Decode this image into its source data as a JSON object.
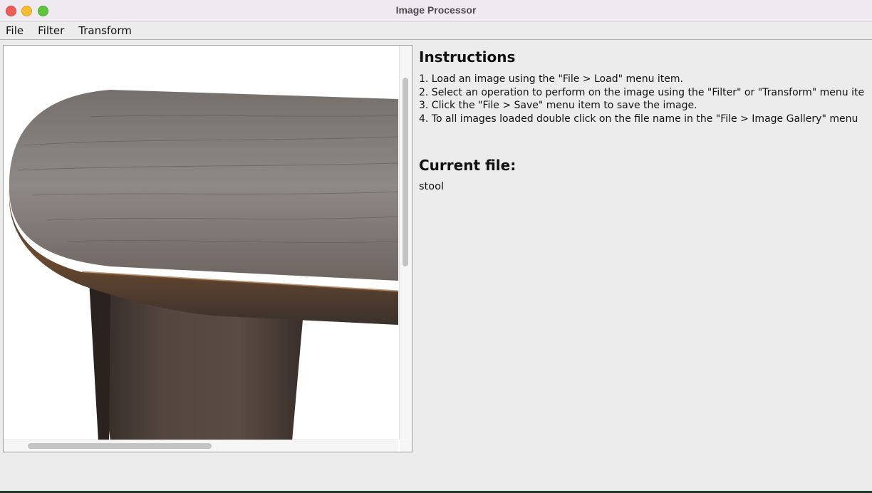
{
  "window": {
    "title": "Image Processor"
  },
  "menu": {
    "items": [
      "File",
      "Filter",
      "Transform"
    ]
  },
  "instructions": {
    "heading": "Instructions",
    "steps": [
      "1. Load an image using the \"File > Load\" menu item.",
      "2. Select an operation to perform on the image using the \"Filter\" or \"Transform\" menu ite",
      "3. Click the \"File > Save\" menu item to save the image.",
      "4. To all images loaded double click on the file name in the \"File > Image Gallery\" menu"
    ]
  },
  "current_file": {
    "heading": "Current file:",
    "name": "stool"
  },
  "image": {
    "subject": "stool"
  }
}
